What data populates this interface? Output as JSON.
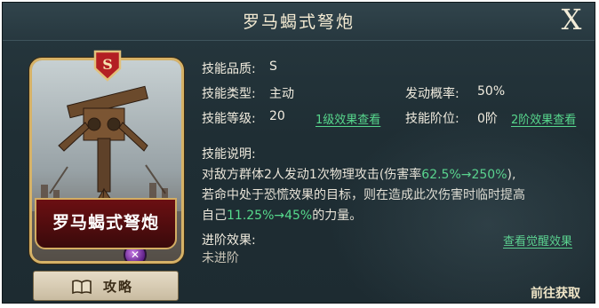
{
  "header": {
    "title": "罗马蝎式弩炮",
    "close_label": "X"
  },
  "card": {
    "name": "罗马蝎式弩炮",
    "grade_badge": "S",
    "icon": "crossbow-unit-art"
  },
  "guide_button": {
    "label": "攻略",
    "icon": "book-icon"
  },
  "skill": {
    "quality_label": "技能品质:",
    "quality_value": "S",
    "type_label": "技能类型:",
    "type_value": "主动",
    "chance_label": "发动概率:",
    "chance_value": "50%",
    "level_label": "技能等级:",
    "level_value": "20",
    "level_link": "1级效果查看",
    "rank_label": "技能阶位:",
    "rank_value": "0阶",
    "rank_link": "2阶效果查看",
    "desc_label": "技能说明:",
    "desc_line1_a": "对敌方群体2人发动1次物理攻击(伤害率",
    "desc_line1_hl": "62.5%→250%",
    "desc_line1_b": "),",
    "desc_line2": "若命中处于恐慌效果的目标，则在造成此次伤害时临时提高",
    "desc_line3_a": "自己",
    "desc_line3_hl": "11.25%→45%",
    "desc_line3_b": "的力量。",
    "advance_label": "进阶效果:",
    "advance_value": "未进阶",
    "awaken_link": "查看觉醒效果"
  },
  "footer": {
    "goto_label": "前往获取"
  },
  "colors": {
    "highlight": "#56d98c",
    "gold_border": "#d6b267",
    "panel_bg": "#27383f"
  }
}
